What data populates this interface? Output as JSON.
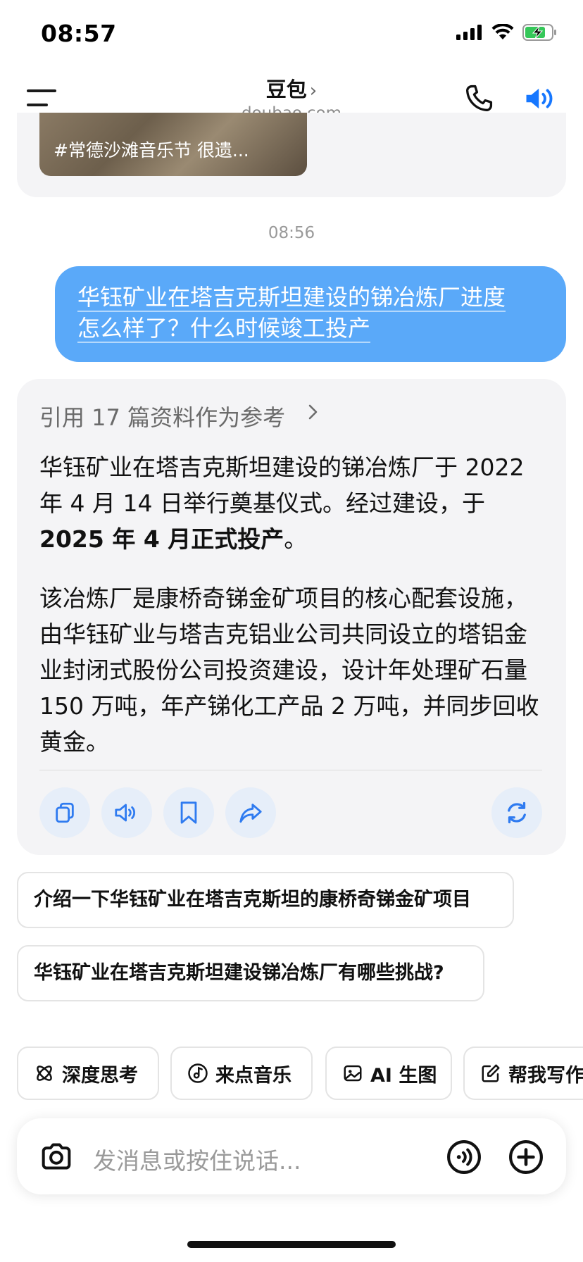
{
  "status_bar": {
    "time": "08:57",
    "icons": [
      "signal-icon",
      "wifi-icon",
      "battery-charging-icon"
    ]
  },
  "header": {
    "title": "豆包",
    "title_chevron": "›",
    "subtitle": "doubao.com",
    "icons": [
      "menu-icon",
      "phone-icon",
      "speaker-icon"
    ],
    "accent_color": "#1677ff"
  },
  "chat": {
    "previous_card": {
      "thumb_text": "#常德沙滩音乐节 很遗..."
    },
    "timestamp": "08:56",
    "user_message": {
      "line1": "华钰矿业在塔吉克斯坦建设的锑冶炼厂进度",
      "line2": "怎么样了？什么时候竣工投产"
    },
    "answer": {
      "reference": "引用 17 篇资料作为参考",
      "para1_normal": "华钰矿业在塔吉克斯坦建设的锑冶炼厂于 2022 年 4 月 14 日举行奠基仪式。经过建设，于 ",
      "para1_bold": "2025 年 4 月正式投产",
      "para1_end": "。",
      "para2": "该冶炼厂是康桥奇锑金矿项目的核心配套设施，由华钰矿业与塔吉克铝业公司共同设立的塔铝金业封闭式股份公司投资建设，设计年处理矿石量 150 万吨，年产锑化工产品 2 万吨，并同步回收黄金。",
      "actions": [
        "copy-icon",
        "read-aloud-icon",
        "bookmark-icon",
        "share-icon",
        "regenerate-icon"
      ]
    },
    "suggestions": [
      "介绍一下华钰矿业在塔吉克斯坦的康桥奇锑金矿项目",
      "华钰矿业在塔吉克斯坦建设锑冶炼厂有哪些挑战?"
    ]
  },
  "tools": [
    {
      "label": "深度思考",
      "icon": "deep-think-icon"
    },
    {
      "label": "来点音乐",
      "icon": "music-icon"
    },
    {
      "label": "AI 生图",
      "icon": "image-icon"
    },
    {
      "label": "帮我写作",
      "icon": "write-icon"
    }
  ],
  "input": {
    "placeholder": "发消息或按住说话...",
    "icons": [
      "camera-icon",
      "voice-icon",
      "add-icon"
    ]
  },
  "colors": {
    "user_bubble": "#5aa9f9",
    "card_bg": "#f4f4f6",
    "action_btn_bg": "#e6eef9",
    "action_icon": "#2f7bf0"
  }
}
